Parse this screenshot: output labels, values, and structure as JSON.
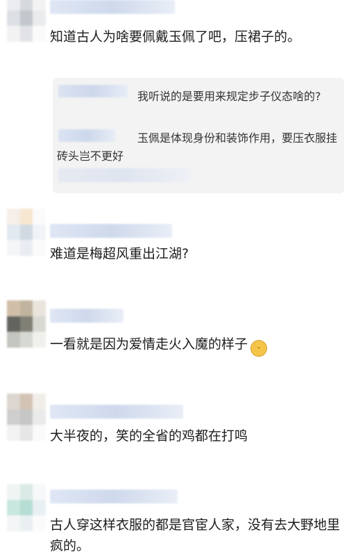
{
  "comments": [
    {
      "text": "知道古人为啥要佩戴玉佩了吧，压裙子的。"
    },
    {
      "text": "难道是梅超风重出江湖?"
    },
    {
      "text": "一看就是因为爱情走火入魔的样子",
      "emoji": "grinning-face-emoji"
    },
    {
      "text": "大半夜的，笑的全省的鸡都在打鸣"
    },
    {
      "text": "古人穿这样衣服的都是官宦人家，没有去大野地里疯的。"
    }
  ],
  "replies": [
    {
      "text": "我听说的是要用来规定步子仪态啥的?"
    },
    {
      "text": "玉佩是体现身份和装饰作用，要压衣服挂砖头岂不更好"
    }
  ]
}
